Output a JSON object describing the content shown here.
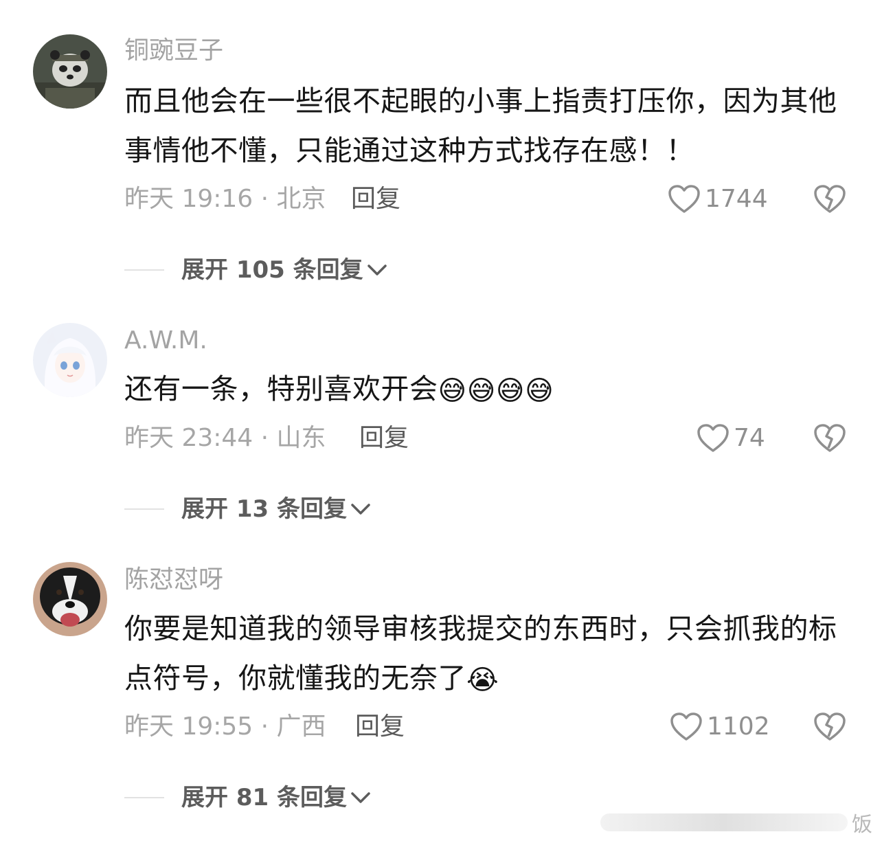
{
  "comments": [
    {
      "username": "铜豌豆子",
      "text": "而且他会在一些很不起眼的小事上指责打压你，因为其他事情他不懂，只能通过这种方式找存在感！！",
      "emojis": "",
      "time_location": "昨天 19:16 · 北京",
      "reply_label": "回复",
      "likes": "1744",
      "expand_label": "展开 105 条回复",
      "avatar_icon": "panda-soldier-avatar"
    },
    {
      "username": "A.W.M.",
      "text": "还有一条，特别喜欢开会",
      "emojis": "😅😅😅😅",
      "time_location": "昨天 23:44 · 山东",
      "reply_label": "回复",
      "likes": "74",
      "expand_label": "展开 13 条回复",
      "avatar_icon": "anime-girl-avatar"
    },
    {
      "username": "陈怼怼呀",
      "text": "你要是知道我的领导审核我提交的东西时，只会抓我的标点符号，你就懂我的无奈了",
      "emojis": "😭",
      "time_location": "昨天 19:55 · 广西",
      "reply_label": "回复",
      "likes": "1102",
      "expand_label": "展开 81 条回复",
      "avatar_icon": "dog-avatar"
    }
  ],
  "icons": {
    "like": "heart-outline-icon",
    "dislike": "broken-heart-icon",
    "expand": "chevron-down-icon"
  },
  "watermark": {
    "text": "饭"
  },
  "colors": {
    "username": "#a3a3a3",
    "text": "#161616",
    "meta": "#a6a6a6",
    "icon": "#8f8f8f"
  }
}
